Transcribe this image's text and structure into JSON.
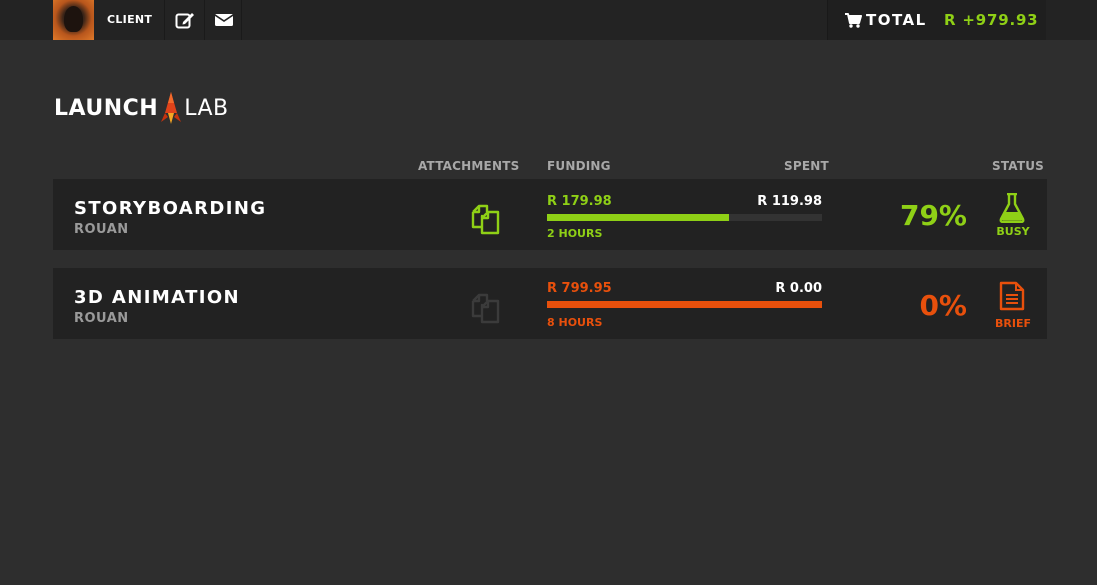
{
  "header": {
    "client_label": "CLIENT",
    "total_label": "TOTAL",
    "total_value": "R +979.93",
    "icons": [
      "edit-icon",
      "envelope-icon",
      "shopping-cart-icon"
    ]
  },
  "logo": {
    "part1": "LAUNCH",
    "part2": "LAB"
  },
  "columns": {
    "attachments": "ATTACHMENTS",
    "funding": "FUNDING",
    "spent": "SPENT",
    "status": "STATUS"
  },
  "colors": {
    "green": "#8fd016",
    "orange": "#e8500c",
    "background": "#2e2e2e",
    "row": "#222222"
  },
  "projects": [
    {
      "title": "STORYBOARDING",
      "subtitle": "ROUAN",
      "funding": "R 179.98",
      "spent": "R 119.98",
      "progress": 0.66,
      "hours": "2 HOURS",
      "percent": "79%",
      "status": "BUSY",
      "status_icon": "flask-icon",
      "attachments_active": true,
      "color": "#8fd016"
    },
    {
      "title": "3D ANIMATION",
      "subtitle": "ROUAN",
      "funding": "R 799.95",
      "spent": "R 0.00",
      "progress": 1.0,
      "hours": "8 HOURS",
      "percent": "0%",
      "status": "BRIEF",
      "status_icon": "document-icon",
      "attachments_active": false,
      "color": "#e8500c"
    }
  ]
}
